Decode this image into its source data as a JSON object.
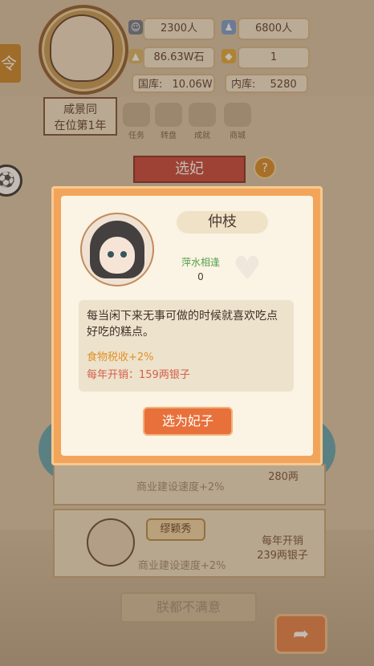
{
  "header": {
    "population": "2300人",
    "troops": "6800人",
    "grain": "86.63W石",
    "gold_count": "1",
    "treasury_label": "国库:",
    "treasury_value": "10.06W",
    "inner_label": "内库:",
    "inner_value": "5280"
  },
  "reign": {
    "line1": "咸景同",
    "line2": "在位第1年"
  },
  "nav": [
    {
      "label": "任务",
      "icon": "scroll-icon"
    },
    {
      "label": "转盘",
      "icon": "wheel-icon"
    },
    {
      "label": "成就",
      "icon": "trophy-icon"
    },
    {
      "label": "商城",
      "icon": "shop-icon"
    }
  ],
  "page_title": "选妃",
  "help_symbol": "?",
  "side_symbol": "⚽",
  "back_symbol": "➦",
  "list": [
    {
      "buff": "商业建设速度+2%",
      "cost": "280两"
    },
    {
      "name": "缪颖秀",
      "buff": "商业建设速度+2%",
      "cost_line1": "每年开销",
      "cost_line2": "239两银子"
    }
  ],
  "dismiss_label": "朕都不满意",
  "dialog": {
    "name": "仲枝",
    "affection_label": "萍水相逢",
    "affection_value": "0",
    "description": "每当闲下来无事可做的时候就喜欢吃点好吃的糕点。",
    "buff": "食物税收+2%",
    "cost": "每年开销：159两银子",
    "button": "选为妃子"
  },
  "colors": {
    "accent": "#e8703a",
    "dialog_frame": "#f2a55a",
    "buff": "#e0922a",
    "cost": "#d45f4c",
    "affection": "#55a04f"
  }
}
